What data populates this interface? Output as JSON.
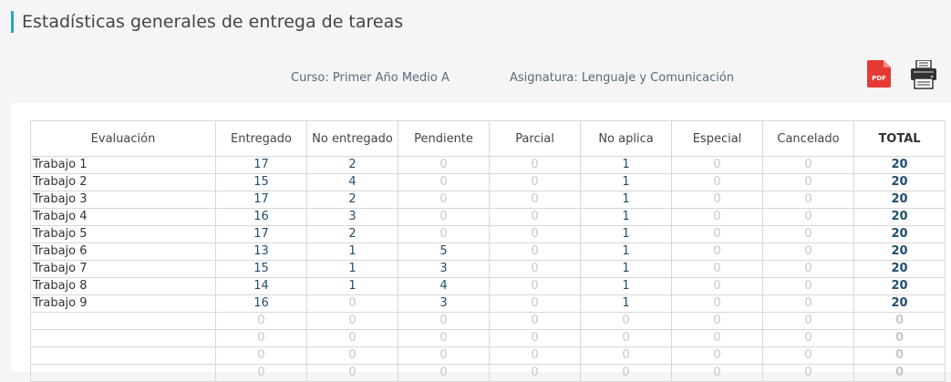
{
  "page": {
    "title": "Estadísticas generales de entrega de tareas",
    "curso": "Curso: Primer Año Medio A",
    "asignatura": "Asignatura: Lenguaje y Comunicación",
    "pdf_label": "PDF",
    "colors": {
      "accent": "#29a3d1",
      "pdf": "#e53935"
    }
  },
  "table": {
    "headers": [
      "Evaluación",
      "Entregado",
      "No entregado",
      "Pendiente",
      "Parcial",
      "No aplica",
      "Especial",
      "Cancelado",
      "TOTAL"
    ],
    "rows": [
      [
        "Trabajo 1",
        "17",
        "2",
        "0",
        "0",
        "1",
        "0",
        "0",
        "20"
      ],
      [
        "Trabajo 2",
        "15",
        "4",
        "0",
        "0",
        "1",
        "0",
        "0",
        "20"
      ],
      [
        "Trabajo 3",
        "17",
        "2",
        "0",
        "0",
        "1",
        "0",
        "0",
        "20"
      ],
      [
        "Trabajo 4",
        "16",
        "3",
        "0",
        "0",
        "1",
        "0",
        "0",
        "20"
      ],
      [
        "Trabajo 5",
        "17",
        "2",
        "0",
        "0",
        "1",
        "0",
        "0",
        "20"
      ],
      [
        "Trabajo 6",
        "13",
        "1",
        "5",
        "0",
        "1",
        "0",
        "0",
        "20"
      ],
      [
        "Trabajo 7",
        "15",
        "1",
        "3",
        "0",
        "1",
        "0",
        "0",
        "20"
      ],
      [
        "Trabajo 8",
        "14",
        "1",
        "4",
        "0",
        "1",
        "0",
        "0",
        "20"
      ],
      [
        "Trabajo 9",
        "16",
        "0",
        "3",
        "0",
        "1",
        "0",
        "0",
        "20"
      ],
      [
        "",
        "0",
        "0",
        "0",
        "0",
        "0",
        "0",
        "0",
        "0"
      ],
      [
        "",
        "0",
        "0",
        "0",
        "0",
        "0",
        "0",
        "0",
        "0"
      ],
      [
        "",
        "0",
        "0",
        "0",
        "0",
        "0",
        "0",
        "0",
        "0"
      ],
      [
        "",
        "0",
        "0",
        "0",
        "0",
        "0",
        "0",
        "0",
        "0"
      ]
    ]
  }
}
